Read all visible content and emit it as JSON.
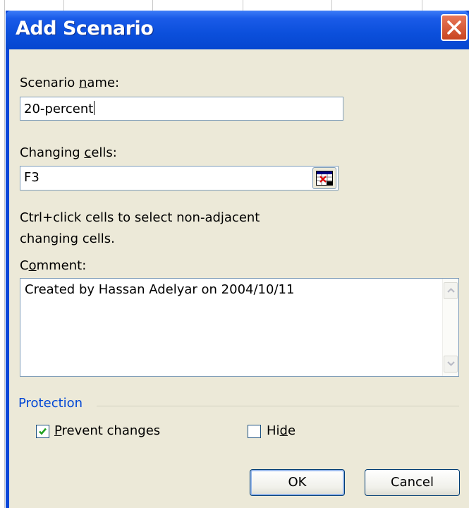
{
  "dialog": {
    "title": "Add Scenario"
  },
  "scenario_name": {
    "label_pre": "Scenario ",
    "label_key": "n",
    "label_post": "ame:",
    "value": "20-percent"
  },
  "changing_cells": {
    "label_pre": "Changing ",
    "label_key": "c",
    "label_post": "ells:",
    "value": "F3",
    "hint_line1": "Ctrl+click cells to select non-adjacent",
    "hint_line2": "changing cells."
  },
  "comment": {
    "label_pre": "C",
    "label_key": "o",
    "label_post": "mment:",
    "value": "Created by Hassan Adelyar on 2004/10/11"
  },
  "protection": {
    "group_label": "Protection",
    "prevent_changes": {
      "label_key": "P",
      "label_post": "revent changes",
      "checked": true
    },
    "hide": {
      "label_pre": "Hi",
      "label_key": "d",
      "label_post": "e",
      "checked": false
    }
  },
  "buttons": {
    "ok": "OK",
    "cancel": "Cancel"
  },
  "colors": {
    "titlebar": "#0a46d8",
    "client": "#ece9d8",
    "group_label": "#0046d5",
    "close_button": "#d8552f"
  },
  "icons": [
    "close-icon",
    "range-selector-icon",
    "scroll-up-icon",
    "scroll-down-icon",
    "checkmark-icon"
  ]
}
